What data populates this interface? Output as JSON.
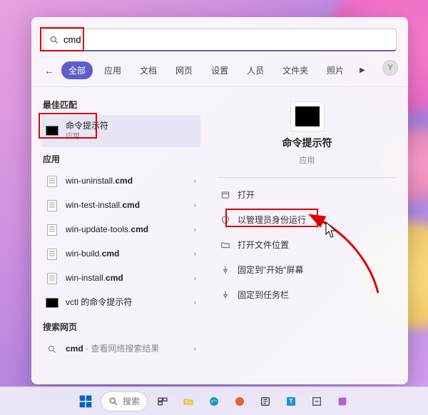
{
  "search": {
    "query": "cmd"
  },
  "tabs": {
    "items": [
      "全部",
      "应用",
      "文档",
      "网页",
      "设置",
      "人员",
      "文件夹",
      "照片"
    ],
    "more_glyph": "▶",
    "account_initial": "Y"
  },
  "sections": {
    "best_match": "最佳匹配",
    "apps": "应用",
    "web": "搜索网页"
  },
  "best_match": {
    "title": "命令提示符",
    "subtitle": "应用"
  },
  "app_results": [
    {
      "prefix": "win-uninstall.",
      "bold": "cmd"
    },
    {
      "prefix": "win-test-install.",
      "bold": "cmd"
    },
    {
      "prefix": "win-update-tools.",
      "bold": "cmd"
    },
    {
      "prefix": "win-build.",
      "bold": "cmd"
    },
    {
      "prefix": "win-install.",
      "bold": "cmd"
    },
    {
      "prefix": "vctl 的命令提示符",
      "bold": ""
    }
  ],
  "web_results": [
    {
      "prefix": "cmd",
      "suffix": " - 查看网络搜索结果"
    }
  ],
  "detail": {
    "title": "命令提示符",
    "subtitle": "应用"
  },
  "actions": [
    {
      "label": "打开"
    },
    {
      "label": "以管理员身份运行"
    },
    {
      "label": "打开文件位置"
    },
    {
      "label": "固定到\"开始\"屏幕"
    },
    {
      "label": "固定到任务栏"
    }
  ],
  "taskbar": {
    "search_placeholder": "搜索"
  }
}
